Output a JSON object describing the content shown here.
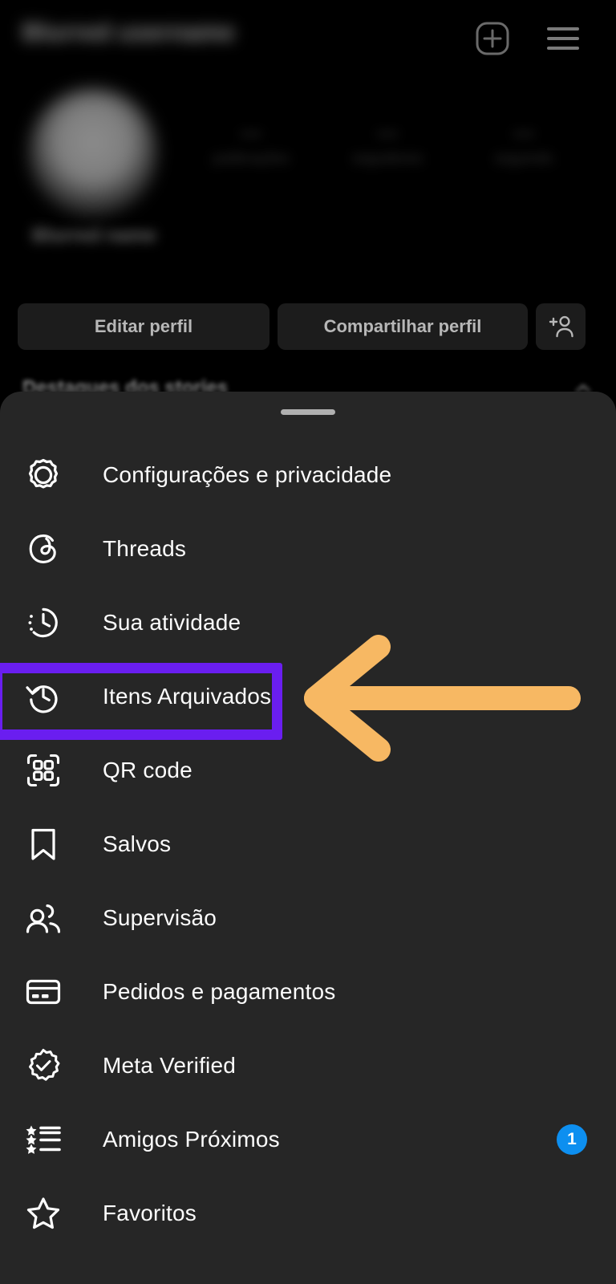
{
  "app": {
    "screen_background": "#000000",
    "sheet_background": "#262626"
  },
  "profile": {
    "username": "Blurred username",
    "display_name": "Blurred name",
    "header_icons": [
      {
        "name": "add-post-icon",
        "glyph": "plus-in-rounded-square"
      },
      {
        "name": "hamburger-menu-icon",
        "glyph": "three-horizontal-lines"
      }
    ],
    "stats": [
      {
        "value": "—",
        "label": "publicações"
      },
      {
        "value": "—",
        "label": "seguidores"
      },
      {
        "value": "—",
        "label": "seguindo"
      }
    ],
    "buttons": {
      "edit_profile": "Editar perfil",
      "share_profile": "Compartilhar perfil",
      "add_person_icon": "add-person-icon"
    },
    "highlights_label": "Destaques dos stories"
  },
  "sheet": {
    "drag_handle": "drag-handle",
    "menu_items": [
      {
        "label": "Configurações e privacidade",
        "icon": "gear-icon",
        "badge": null
      },
      {
        "label": "Threads",
        "icon": "threads-icon",
        "badge": null
      },
      {
        "label": "Sua atividade",
        "icon": "activity-clock-icon",
        "badge": null
      },
      {
        "label": "Itens Arquivados",
        "icon": "archive-history-icon",
        "badge": null
      },
      {
        "label": "QR code",
        "icon": "qr-code-icon",
        "badge": null
      },
      {
        "label": "Salvos",
        "icon": "bookmark-icon",
        "badge": null
      },
      {
        "label": "Supervisão",
        "icon": "supervision-people-icon",
        "badge": null
      },
      {
        "label": "Pedidos e pagamentos",
        "icon": "credit-card-icon",
        "badge": null
      },
      {
        "label": "Meta Verified",
        "icon": "verified-badge-icon",
        "badge": null
      },
      {
        "label": "Amigos Próximos",
        "icon": "close-friends-list-icon",
        "badge": "1"
      },
      {
        "label": "Favoritos",
        "icon": "star-icon",
        "badge": null
      }
    ]
  },
  "annotations": {
    "highlight_box": {
      "name": "highlight-box",
      "color": "#6a1ef0",
      "targets": "Itens Arquivados"
    },
    "arrow": {
      "name": "pointer-arrow",
      "color": "#f7b863",
      "direction": "left"
    }
  },
  "colors": {
    "accent_purple": "#6a1ef0",
    "accent_orange": "#f7b863",
    "badge_blue": "#0d8ff0",
    "sheet_bg": "#262626",
    "page_bg": "#000000",
    "text_primary": "#fcfcfc",
    "text_muted": "#b7b7b7"
  }
}
